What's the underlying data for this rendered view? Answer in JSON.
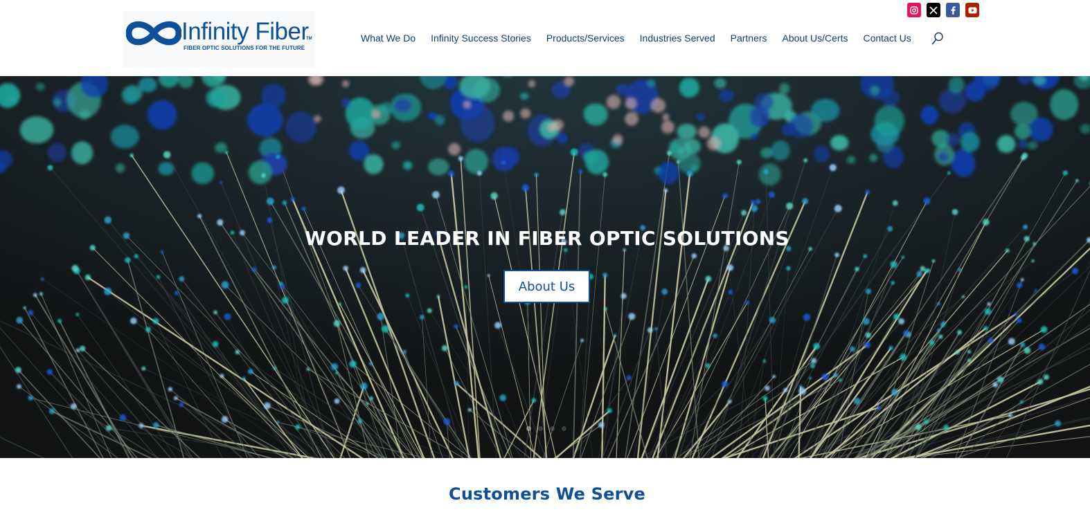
{
  "header": {
    "logo": {
      "name": "Infinity Fiber",
      "trademark": "TM",
      "tagline": "FIBER OPTIC SOLUTIONS FOR THE FUTURE",
      "color": "#0d4f99"
    },
    "nav": [
      {
        "label": "What We Do"
      },
      {
        "label": "Infinity Success Stories"
      },
      {
        "label": "Products/Services"
      },
      {
        "label": "Industries Served"
      },
      {
        "label": "Partners"
      },
      {
        "label": "About Us/Certs"
      },
      {
        "label": "Contact Us"
      }
    ],
    "search_icon": "search-icon",
    "social": [
      {
        "icon": "instagram-icon",
        "color": "#e4135d"
      },
      {
        "icon": "x-twitter-icon",
        "color": "#000000"
      },
      {
        "icon": "facebook-icon",
        "color": "#3b5998"
      },
      {
        "icon": "youtube-icon",
        "color": "#a82400"
      }
    ]
  },
  "hero": {
    "title": "WORLD LEADER IN FIBER OPTIC SOLUTIONS",
    "button_label": "About Us",
    "slide_count": 4,
    "active_slide": 1
  },
  "section": {
    "title": "Customers We Serve"
  },
  "colors": {
    "brand": "#0d4f99",
    "nav_text": "#0e3d73",
    "hero_bg": "#131516"
  }
}
